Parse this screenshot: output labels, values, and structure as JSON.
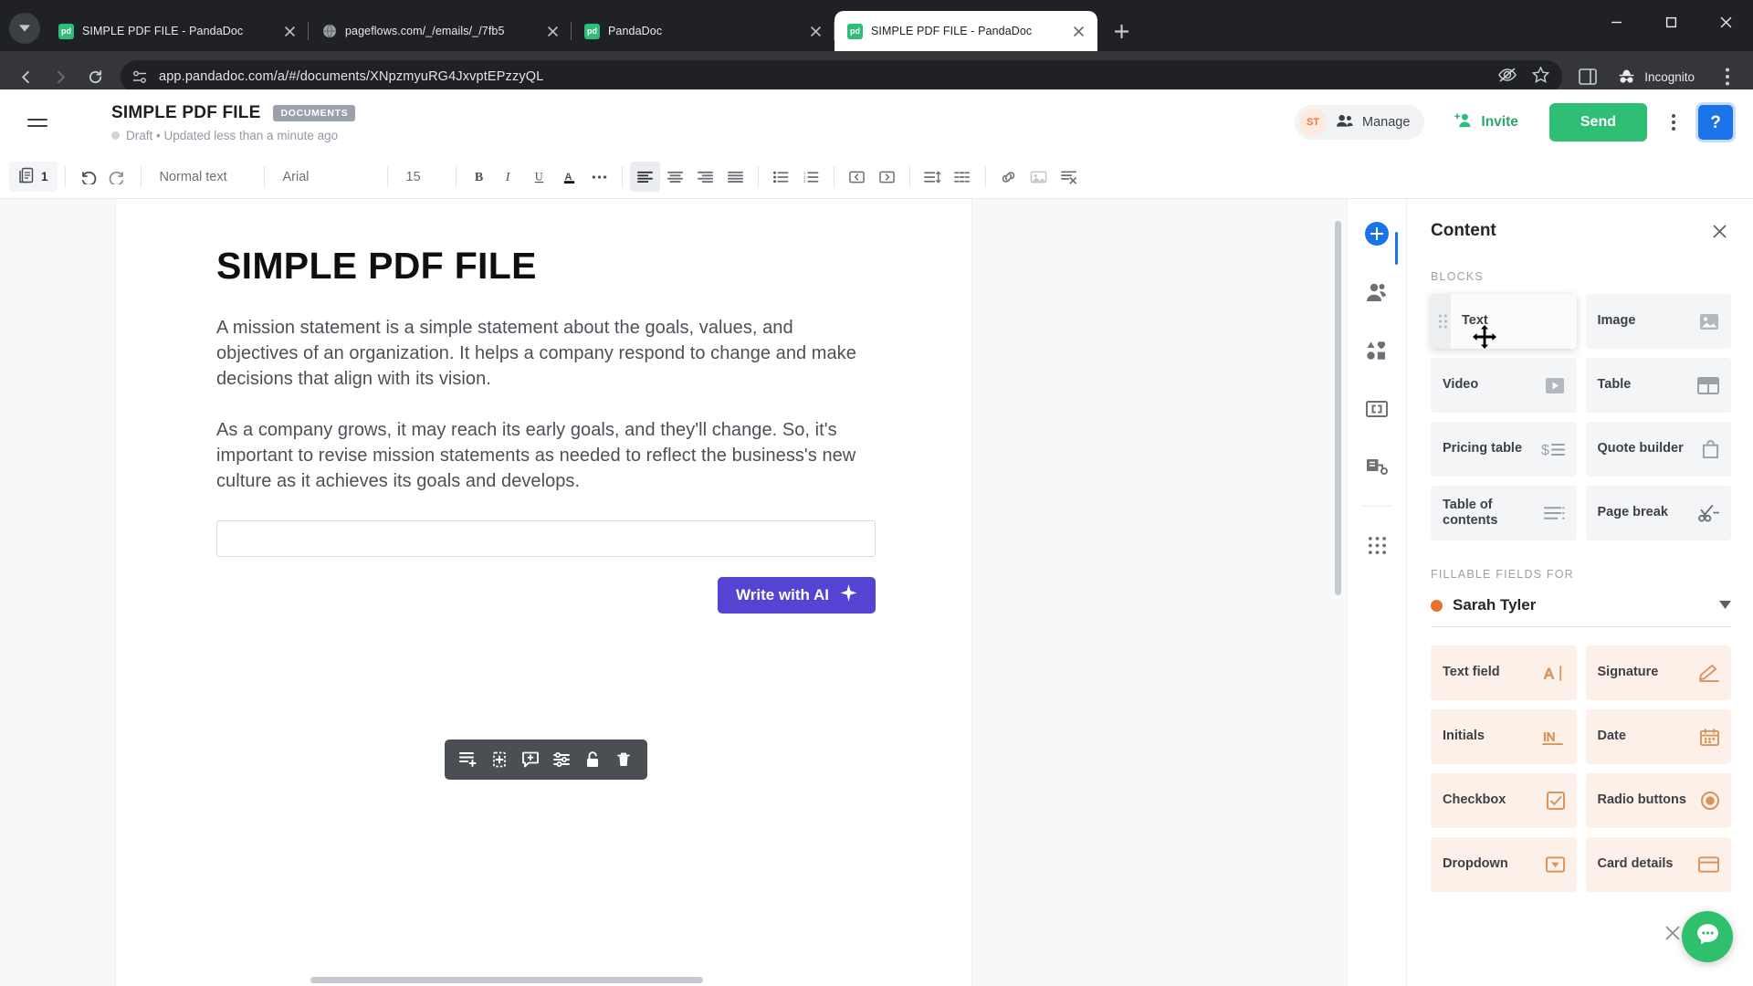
{
  "browser": {
    "tabs": [
      {
        "title": "SIMPLE PDF FILE - PandaDoc",
        "favicon": "pandadoc-icon",
        "active": false
      },
      {
        "title": "pageflows.com/_/emails/_/7fb5",
        "favicon": "globe-icon",
        "active": false
      },
      {
        "title": "PandaDoc",
        "favicon": "pandadoc-icon",
        "active": false
      },
      {
        "title": "SIMPLE PDF FILE - PandaDoc",
        "favicon": "pandadoc-icon",
        "active": true
      }
    ],
    "new_tab_label": "+",
    "url": "app.pandadoc.com/a/#/documents/XNpzmyuRG4JxvptEPzzyQL",
    "incognito_label": "Incognito"
  },
  "header": {
    "doc_title": "SIMPLE PDF FILE",
    "badge": "DOCUMENTS",
    "status": "Draft • Updated less than a minute ago",
    "avatar_initials": "ST",
    "manage_label": "Manage",
    "invite_label": "Invite",
    "send_label": "Send",
    "help_label": "?",
    "accent_green": "#2fbf74",
    "accent_blue": "#1a73e8"
  },
  "toolbar": {
    "page_number": "1",
    "text_style": "Normal text",
    "font_family": "Arial",
    "font_size": "15"
  },
  "document": {
    "heading": "SIMPLE PDF FILE",
    "paragraph1": "A mission statement is a simple statement about the goals, values, and objectives of an organization. It helps a company respond to change and make decisions that align with its vision.",
    "paragraph2": "As a company grows, it may reach its early goals, and they'll change. So, it's important to revise mission statements as needed to reflect the business's new culture as it achieves its goals and develops.",
    "ai_input_value": "",
    "ai_button_label": "Write with AI"
  },
  "panel": {
    "title": "Content",
    "blocks_label": "BLOCKS",
    "blocks": [
      {
        "label": "Text",
        "icon": "drag-move-icon"
      },
      {
        "label": "Image",
        "icon": "image-icon"
      },
      {
        "label": "Video",
        "icon": "video-play-icon"
      },
      {
        "label": "Table",
        "icon": "table-icon"
      },
      {
        "label": "Pricing table",
        "icon": "pricing-table-icon"
      },
      {
        "label": "Quote builder",
        "icon": "quote-bag-icon"
      },
      {
        "label": "Table of contents",
        "icon": "toc-icon"
      },
      {
        "label": "Page break",
        "icon": "scissors-icon"
      }
    ],
    "fillable_label": "FILLABLE FIELDS FOR",
    "recipient": "Sarah Tyler",
    "recipient_color": "#e5742b",
    "fields": [
      {
        "label": "Text field",
        "icon": "text-field-icon"
      },
      {
        "label": "Signature",
        "icon": "signature-icon"
      },
      {
        "label": "Initials",
        "icon": "initials-icon"
      },
      {
        "label": "Date",
        "icon": "calendar-icon"
      },
      {
        "label": "Checkbox",
        "icon": "checkbox-icon"
      },
      {
        "label": "Radio buttons",
        "icon": "radio-icon"
      },
      {
        "label": "Dropdown",
        "icon": "dropdown-icon"
      },
      {
        "label": "Card details",
        "icon": "card-icon"
      }
    ]
  }
}
